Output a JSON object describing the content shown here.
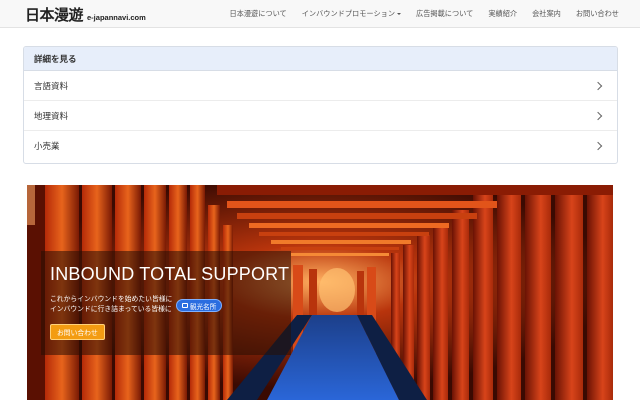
{
  "header": {
    "brand_jp": "日本漫遊",
    "brand_domain": "e-japannavi.com",
    "nav": [
      {
        "label": "日本漫遊について"
      },
      {
        "label": "インバウンドプロモーション"
      },
      {
        "label": "広告掲載について"
      },
      {
        "label": "実績紹介"
      },
      {
        "label": "会社案内"
      },
      {
        "label": "お問い合わせ"
      }
    ]
  },
  "details": {
    "title": "詳細を見る",
    "items": [
      {
        "label": "言語資料"
      },
      {
        "label": "地理資料"
      },
      {
        "label": "小売業"
      }
    ]
  },
  "hero": {
    "title": "INBOUND TOTAL SUPPORT",
    "line1": "これからインバウンドを始めたい皆様に",
    "line2": "インバウンドに行き詰まっている皆様に",
    "tag": "観光名所",
    "cta": "お問い合わせ"
  },
  "colors": {
    "navbar_bg": "#f8f8f8",
    "panel_head_bg": "#e7eefa",
    "torii_red": "#d8441a",
    "cta_orange": "#f39c12",
    "tag_blue": "#2a6de0"
  }
}
